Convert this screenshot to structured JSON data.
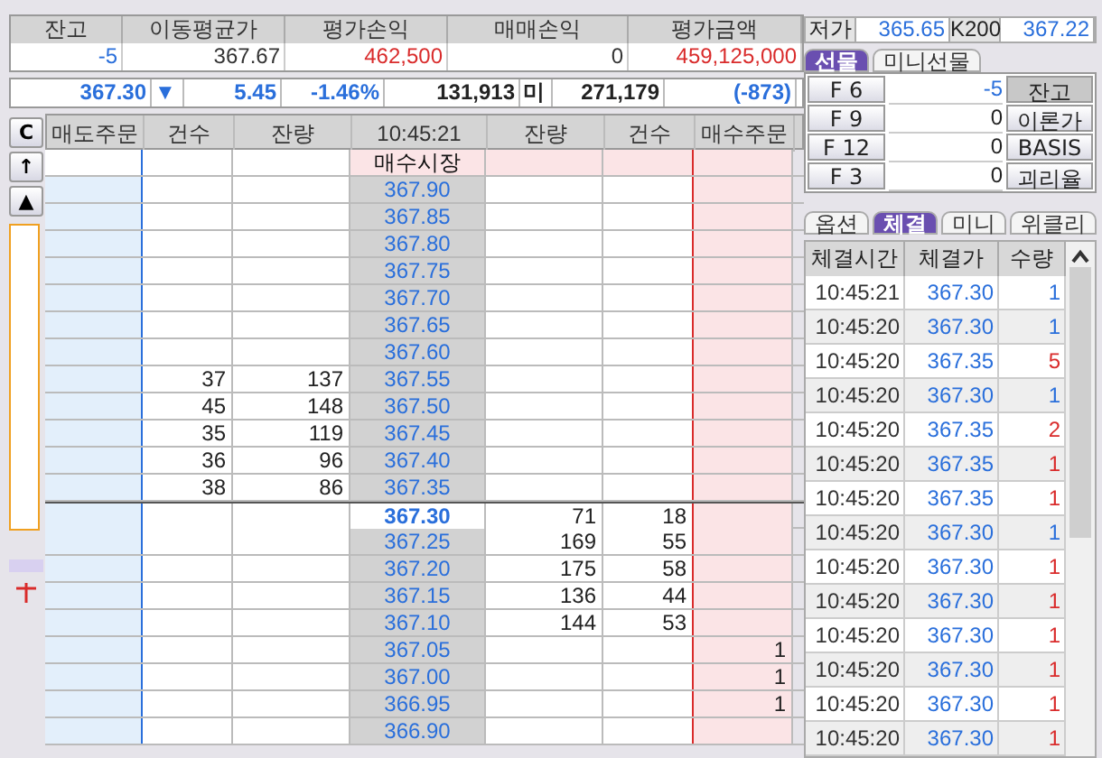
{
  "position": {
    "columns": [
      "잔고",
      "이동평균가",
      "평가손익",
      "매매손익",
      "평가금액"
    ],
    "values": [
      {
        "text": "-5",
        "color": "#2a6fdb"
      },
      {
        "text": "367.67",
        "color": "#333333"
      },
      {
        "text": "462,500",
        "color": "#d92b2b"
      },
      {
        "text": "0",
        "color": "#333333"
      },
      {
        "text": "459,125,000",
        "color": "#d92b2b"
      }
    ]
  },
  "quote": [
    {
      "text": "367.30",
      "color": "#2a6fdb"
    },
    {
      "text": "▼",
      "color": "#2a6fdb"
    },
    {
      "text": "5.45",
      "color": "#2a6fdb"
    },
    {
      "text": "-1.46%",
      "color": "#2a6fdb"
    },
    {
      "text": "131,913",
      "color": "#222222"
    },
    {
      "text": "미",
      "color": "#222222"
    },
    {
      "text": "271,179",
      "color": "#222222"
    },
    {
      "text": "(-873)",
      "color": "#2a6fdb"
    }
  ],
  "side_buttons": [
    "C",
    "↑",
    "▲"
  ],
  "orderbook": {
    "columns": [
      "매도주문",
      "건수",
      "잔량",
      "10:45:21",
      "잔량",
      "건수",
      "매수주문"
    ],
    "rows": [
      {
        "kind": "market",
        "price": "매수시장",
        "sell_count": "",
        "sell_qty": "",
        "buy_qty": "",
        "buy_count": "",
        "buy_order": "",
        "current": false
      },
      {
        "kind": "price",
        "price": "367.90",
        "sell_count": "",
        "sell_qty": "",
        "buy_qty": "",
        "buy_count": "",
        "buy_order": "",
        "current": false
      },
      {
        "kind": "price",
        "price": "367.85",
        "sell_count": "",
        "sell_qty": "",
        "buy_qty": "",
        "buy_count": "",
        "buy_order": "",
        "current": false
      },
      {
        "kind": "price",
        "price": "367.80",
        "sell_count": "",
        "sell_qty": "",
        "buy_qty": "",
        "buy_count": "",
        "buy_order": "",
        "current": false
      },
      {
        "kind": "price",
        "price": "367.75",
        "sell_count": "",
        "sell_qty": "",
        "buy_qty": "",
        "buy_count": "",
        "buy_order": "",
        "current": false
      },
      {
        "kind": "price",
        "price": "367.70",
        "sell_count": "",
        "sell_qty": "",
        "buy_qty": "",
        "buy_count": "",
        "buy_order": "",
        "current": false
      },
      {
        "kind": "price",
        "price": "367.65",
        "sell_count": "",
        "sell_qty": "",
        "buy_qty": "",
        "buy_count": "",
        "buy_order": "",
        "current": false
      },
      {
        "kind": "price",
        "price": "367.60",
        "sell_count": "",
        "sell_qty": "",
        "buy_qty": "",
        "buy_count": "",
        "buy_order": "",
        "current": false
      },
      {
        "kind": "price",
        "price": "367.55",
        "sell_count": "37",
        "sell_qty": "137",
        "buy_qty": "",
        "buy_count": "",
        "buy_order": "",
        "current": false
      },
      {
        "kind": "price",
        "price": "367.50",
        "sell_count": "45",
        "sell_qty": "148",
        "buy_qty": "",
        "buy_count": "",
        "buy_order": "",
        "current": false
      },
      {
        "kind": "price",
        "price": "367.45",
        "sell_count": "35",
        "sell_qty": "119",
        "buy_qty": "",
        "buy_count": "",
        "buy_order": "",
        "current": false
      },
      {
        "kind": "price",
        "price": "367.40",
        "sell_count": "36",
        "sell_qty": "96",
        "buy_qty": "",
        "buy_count": "",
        "buy_order": "",
        "current": false
      },
      {
        "kind": "price",
        "price": "367.35",
        "sell_count": "38",
        "sell_qty": "86",
        "buy_qty": "",
        "buy_count": "",
        "buy_order": "",
        "current": false
      },
      {
        "kind": "price",
        "price": "367.30",
        "sell_count": "",
        "sell_qty": "",
        "buy_qty": "71",
        "buy_count": "18",
        "buy_order": "",
        "current": true
      },
      {
        "kind": "price",
        "price": "367.25",
        "sell_count": "",
        "sell_qty": "",
        "buy_qty": "169",
        "buy_count": "55",
        "buy_order": "",
        "current": false
      },
      {
        "kind": "price",
        "price": "367.20",
        "sell_count": "",
        "sell_qty": "",
        "buy_qty": "175",
        "buy_count": "58",
        "buy_order": "",
        "current": false
      },
      {
        "kind": "price",
        "price": "367.15",
        "sell_count": "",
        "sell_qty": "",
        "buy_qty": "136",
        "buy_count": "44",
        "buy_order": "",
        "current": false
      },
      {
        "kind": "price",
        "price": "367.10",
        "sell_count": "",
        "sell_qty": "",
        "buy_qty": "144",
        "buy_count": "53",
        "buy_order": "",
        "current": false
      },
      {
        "kind": "price",
        "price": "367.05",
        "sell_count": "",
        "sell_qty": "",
        "buy_qty": "",
        "buy_count": "",
        "buy_order": "1",
        "current": false
      },
      {
        "kind": "price",
        "price": "367.00",
        "sell_count": "",
        "sell_qty": "",
        "buy_qty": "",
        "buy_count": "",
        "buy_order": "1",
        "current": false
      },
      {
        "kind": "price",
        "price": "366.95",
        "sell_count": "",
        "sell_qty": "",
        "buy_qty": "",
        "buy_count": "",
        "buy_order": "1",
        "current": false
      },
      {
        "kind": "price",
        "price": "366.90",
        "sell_count": "",
        "sell_qty": "",
        "buy_qty": "",
        "buy_count": "",
        "buy_order": "",
        "current": false
      }
    ]
  },
  "range": [
    {
      "label": "저가",
      "value": "365.65"
    },
    {
      "label": "K200",
      "value": "367.22"
    }
  ],
  "futures_tabs": [
    {
      "label": "선물",
      "selected": true
    },
    {
      "label": "미니선물",
      "selected": false
    }
  ],
  "futures": [
    {
      "label": "F 6",
      "value": "-5",
      "color": "#2a6fdb",
      "button": "잔고",
      "selected": true
    },
    {
      "label": "F 9",
      "value": "0",
      "color": "#222222",
      "button": "이론가",
      "selected": false
    },
    {
      "label": "F 12",
      "value": "0",
      "color": "#222222",
      "button": "BASIS",
      "selected": false
    },
    {
      "label": "F 3",
      "value": "0",
      "color": "#222222",
      "button": "괴리율",
      "selected": false
    }
  ],
  "trade_tabs": [
    {
      "label": "옵션",
      "selected": false
    },
    {
      "label": "체결",
      "selected": true
    },
    {
      "label": "미니",
      "selected": false
    },
    {
      "label": "위클리",
      "selected": false
    }
  ],
  "trades": {
    "columns": [
      "체결시간",
      "체결가",
      "수량"
    ],
    "rows": [
      {
        "time": "10:45:21",
        "price": "367.30",
        "qty": "1",
        "color": "#2a6fdb"
      },
      {
        "time": "10:45:20",
        "price": "367.30",
        "qty": "1",
        "color": "#2a6fdb"
      },
      {
        "time": "10:45:20",
        "price": "367.35",
        "qty": "5",
        "color": "#d92b2b"
      },
      {
        "time": "10:45:20",
        "price": "367.30",
        "qty": "1",
        "color": "#2a6fdb"
      },
      {
        "time": "10:45:20",
        "price": "367.35",
        "qty": "2",
        "color": "#d92b2b"
      },
      {
        "time": "10:45:20",
        "price": "367.35",
        "qty": "1",
        "color": "#d92b2b"
      },
      {
        "time": "10:45:20",
        "price": "367.35",
        "qty": "1",
        "color": "#d92b2b"
      },
      {
        "time": "10:45:20",
        "price": "367.30",
        "qty": "1",
        "color": "#2a6fdb"
      },
      {
        "time": "10:45:20",
        "price": "367.30",
        "qty": "1",
        "color": "#d92b2b"
      },
      {
        "time": "10:45:20",
        "price": "367.30",
        "qty": "1",
        "color": "#d92b2b"
      },
      {
        "time": "10:45:20",
        "price": "367.30",
        "qty": "1",
        "color": "#d92b2b"
      },
      {
        "time": "10:45:20",
        "price": "367.30",
        "qty": "1",
        "color": "#d92b2b"
      },
      {
        "time": "10:45:20",
        "price": "367.30",
        "qty": "1",
        "color": "#d92b2b"
      },
      {
        "time": "10:45:20",
        "price": "367.30",
        "qty": "1",
        "color": "#d92b2b"
      }
    ]
  }
}
